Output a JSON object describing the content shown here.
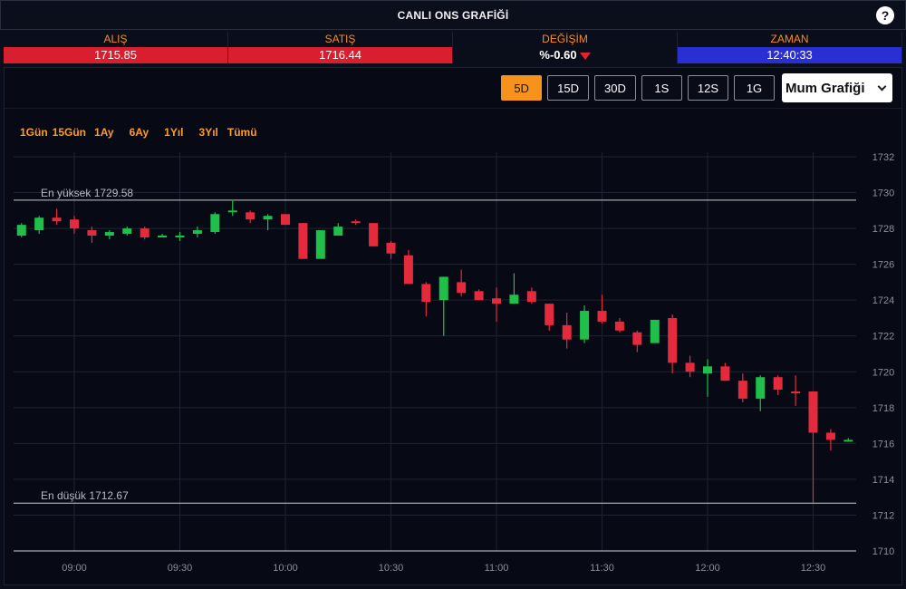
{
  "header": {
    "title": "CANLI ONS GRAFİĞİ",
    "help_label": "?"
  },
  "stats": {
    "bid_label": "ALIŞ",
    "bid_value": "1715.85",
    "ask_label": "SATIŞ",
    "ask_value": "1716.44",
    "change_label": "DEĞİŞİM",
    "change_value": "%-0.60",
    "time_label": "ZAMAN",
    "time_value": "12:40:33"
  },
  "toolbar": {
    "periods": [
      "5D",
      "15D",
      "30D",
      "1S",
      "12S",
      "1G"
    ],
    "active_period": "5D",
    "chart_type": "Mum Grafiği"
  },
  "ranges": [
    "1Gün",
    "15Gün",
    "1Ay",
    "6Ay",
    "1Yıl",
    "3Yıl",
    "Tümü"
  ],
  "colors": {
    "up": "#1fbf4a",
    "down": "#e32b3d",
    "accent": "#f7931a",
    "grid": "#1e2433"
  },
  "chart_data": {
    "type": "candlestick",
    "ylim": [
      1710,
      1732
    ],
    "yticks": [
      "1732",
      "1730",
      "1728",
      "1726",
      "1724",
      "1722",
      "1720",
      "1718",
      "1716",
      "1714",
      "1712",
      "1710"
    ],
    "xticks": [
      "09:00",
      "09:30",
      "10:00",
      "10:30",
      "11:00",
      "11:30",
      "12:00",
      "12:30"
    ],
    "high_line": {
      "label": "En yüksek 1729.58",
      "value": 1729.58
    },
    "low_line": {
      "label": "En düşük 1712.67",
      "value": 1712.67
    },
    "candles": [
      [
        1727.6,
        1728.3,
        1727.5,
        1728.2
      ],
      [
        1727.9,
        1728.7,
        1727.7,
        1728.6
      ],
      [
        1728.6,
        1729.1,
        1728.2,
        1728.4
      ],
      [
        1728.5,
        1728.7,
        1727.7,
        1728.0
      ],
      [
        1727.9,
        1728.1,
        1727.2,
        1727.6
      ],
      [
        1727.6,
        1727.9,
        1727.4,
        1727.8
      ],
      [
        1727.7,
        1728.1,
        1727.6,
        1728.0
      ],
      [
        1728.0,
        1728.1,
        1727.4,
        1727.5
      ],
      [
        1727.6,
        1727.7,
        1727.5,
        1727.6
      ],
      [
        1727.6,
        1727.8,
        1727.3,
        1727.6
      ],
      [
        1727.7,
        1728.1,
        1727.5,
        1727.9
      ],
      [
        1727.8,
        1728.9,
        1727.7,
        1728.8
      ],
      [
        1728.9,
        1729.6,
        1728.7,
        1729.0
      ],
      [
        1728.9,
        1729.0,
        1728.3,
        1728.5
      ],
      [
        1728.5,
        1728.8,
        1727.9,
        1728.7
      ],
      [
        1728.8,
        1728.8,
        1728.2,
        1728.2
      ],
      [
        1728.3,
        1728.3,
        1726.3,
        1726.3
      ],
      [
        1726.3,
        1727.9,
        1726.3,
        1727.9
      ],
      [
        1727.6,
        1728.3,
        1727.6,
        1728.1
      ],
      [
        1728.4,
        1728.5,
        1728.2,
        1728.3
      ],
      [
        1728.3,
        1728.3,
        1727.0,
        1727.0
      ],
      [
        1727.2,
        1727.3,
        1726.3,
        1726.6
      ],
      [
        1726.5,
        1726.8,
        1724.9,
        1724.9
      ],
      [
        1724.9,
        1725.0,
        1723.1,
        1723.9
      ],
      [
        1724.0,
        1725.3,
        1722.0,
        1725.3
      ],
      [
        1725.0,
        1725.7,
        1724.2,
        1724.4
      ],
      [
        1724.5,
        1724.6,
        1724.0,
        1724.0
      ],
      [
        1724.1,
        1724.7,
        1722.8,
        1723.8
      ],
      [
        1723.8,
        1725.5,
        1723.8,
        1724.3
      ],
      [
        1724.5,
        1724.7,
        1723.8,
        1723.9
      ],
      [
        1723.8,
        1723.8,
        1722.3,
        1722.6
      ],
      [
        1722.6,
        1723.3,
        1721.3,
        1721.8
      ],
      [
        1721.8,
        1723.7,
        1721.6,
        1723.4
      ],
      [
        1723.4,
        1724.3,
        1722.7,
        1722.8
      ],
      [
        1722.8,
        1723.0,
        1722.2,
        1722.3
      ],
      [
        1722.2,
        1722.3,
        1721.1,
        1721.5
      ],
      [
        1721.6,
        1722.9,
        1721.6,
        1722.9
      ],
      [
        1723.0,
        1723.2,
        1719.9,
        1720.5
      ],
      [
        1720.5,
        1720.9,
        1719.7,
        1720.0
      ],
      [
        1719.9,
        1720.7,
        1718.6,
        1720.3
      ],
      [
        1720.3,
        1720.5,
        1719.5,
        1719.5
      ],
      [
        1719.5,
        1719.9,
        1718.3,
        1718.5
      ],
      [
        1718.5,
        1719.8,
        1717.8,
        1719.7
      ],
      [
        1719.7,
        1719.8,
        1718.7,
        1719.0
      ],
      [
        1718.9,
        1719.8,
        1718.1,
        1718.8
      ],
      [
        1718.9,
        1718.9,
        1712.7,
        1716.6
      ],
      [
        1716.6,
        1716.8,
        1715.6,
        1716.2
      ],
      [
        1716.2,
        1716.3,
        1716.1,
        1716.2
      ]
    ]
  }
}
